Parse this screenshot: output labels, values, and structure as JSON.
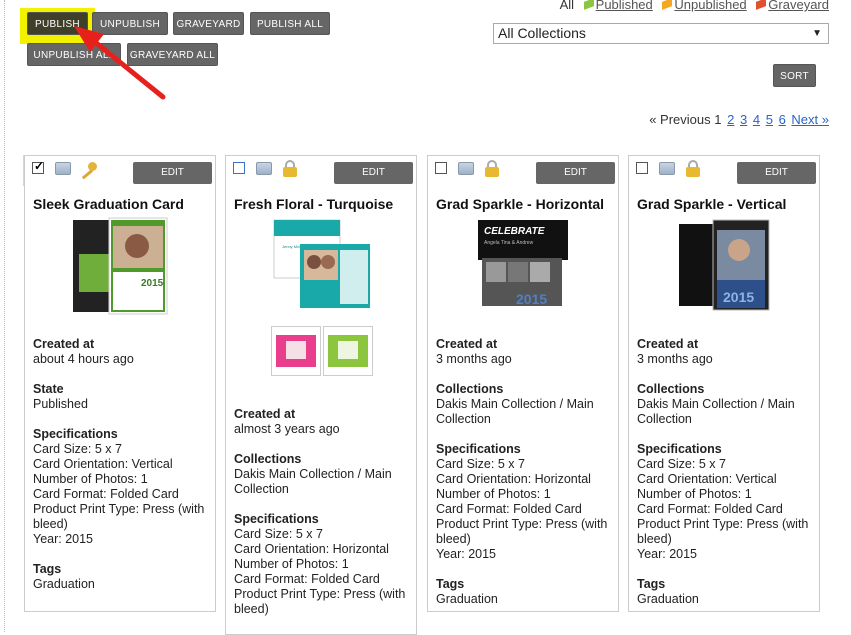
{
  "toolbar": {
    "publish": "PUBLISH",
    "unpublish": "UNPUBLISH",
    "graveyard": "GRAVEYARD",
    "publish_all": "PUBLISH ALL",
    "unpublish_all": "UNPUBLISH ALL",
    "graveyard_all": "GRAVEYARD ALL",
    "sort": "SORT"
  },
  "filters": {
    "all": "All",
    "published": "Published",
    "unpublished": "Unpublished",
    "graveyard": "Graveyard",
    "colors": {
      "published": "#8cc63f",
      "unpublished": "#f5a623",
      "graveyard": "#e0522f"
    }
  },
  "collection_select": {
    "value": "All Collections"
  },
  "pager": {
    "prev": "« Previous",
    "current": "1",
    "pages": [
      "2",
      "3",
      "4",
      "5",
      "6"
    ],
    "next": "Next »"
  },
  "cards": [
    {
      "title": "Sleek Graduation Card",
      "edit": "EDIT",
      "created_label": "Created at",
      "created": "about 4 hours ago",
      "state_label": "State",
      "state": "Published",
      "spec_label": "Specifications",
      "specs": [
        "Card Size: 5 x 7",
        "Card Orientation: Vertical",
        "Number of Photos: 1",
        "Card Format: Folded Card",
        "Product Print Type: Press (with bleed)",
        "Year: 2015"
      ],
      "tags_label": "Tags",
      "tags": "Graduation"
    },
    {
      "title": "Fresh Floral - Turquoise",
      "edit": "EDIT",
      "created_label": "Created at",
      "created": "almost 3 years ago",
      "coll_label": "Collections",
      "collections": "Dakis Main Collection / Main Collection",
      "spec_label": "Specifications",
      "specs": [
        "Card Size: 5 x 7",
        "Card Orientation: Horizontal",
        "Number of Photos: 1",
        "Card Format: Folded Card",
        "Product Print Type: Press (with bleed)"
      ]
    },
    {
      "title": "Grad Sparkle - Horizontal",
      "edit": "EDIT",
      "created_label": "Created at",
      "created": "3 months ago",
      "coll_label": "Collections",
      "collections": "Dakis Main Collection / Main Collection",
      "spec_label": "Specifications",
      "specs": [
        "Card Size: 5 x 7",
        "Card Orientation: Horizontal",
        "Number of Photos: 1",
        "Card Format: Folded Card",
        "Product Print Type: Press (with bleed)",
        "Year: 2015"
      ],
      "tags_label": "Tags",
      "tags": "Graduation"
    },
    {
      "title": "Grad Sparkle - Vertical",
      "edit": "EDIT",
      "created_label": "Created at",
      "created": "3 months ago",
      "coll_label": "Collections",
      "collections": "Dakis Main Collection / Main Collection",
      "spec_label": "Specifications",
      "specs": [
        "Card Size: 5 x 7",
        "Card Orientation: Vertical",
        "Number of Photos: 1",
        "Card Format: Folded Card",
        "Product Print Type: Press (with bleed)",
        "Year: 2015"
      ],
      "tags_label": "Tags",
      "tags": "Graduation"
    }
  ],
  "thumb_text": {
    "c2_names": "Jenny McCalister and Josh Phoenix",
    "c3_brand": "CELEBRATE",
    "c3_sub": "Angela Tina & Andrew",
    "year": "2015"
  },
  "annotation": {
    "arrow_color": "#e8201c",
    "highlight_color": "#f2f200"
  }
}
